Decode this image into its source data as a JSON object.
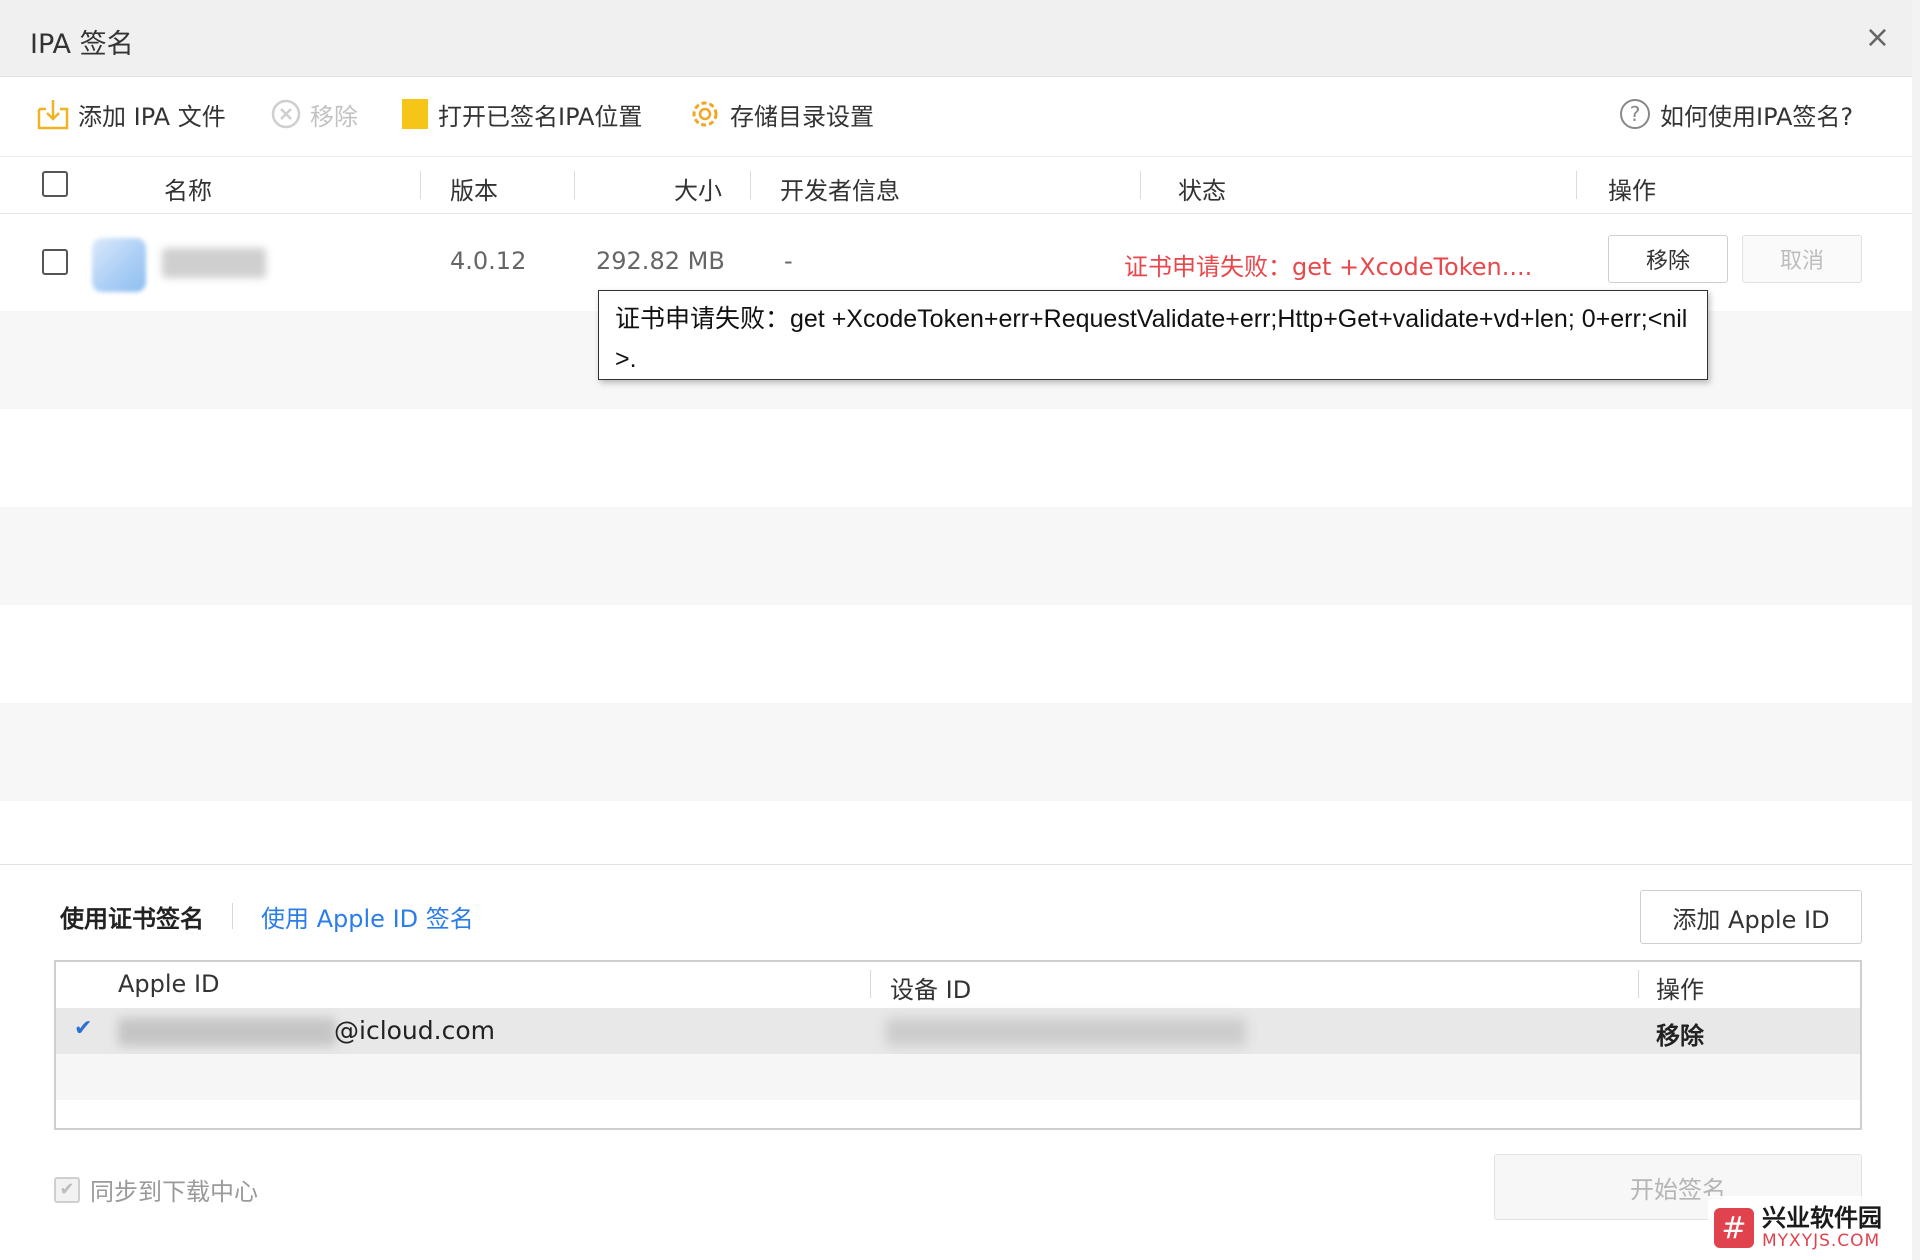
{
  "window": {
    "title": "IPA 签名",
    "close_glyph": "×"
  },
  "toolbar": {
    "add_ipa": "添加 IPA 文件",
    "remove": "移除",
    "open_signed": "打开已签名IPA位置",
    "storage_settings": "存储目录设置",
    "help": "如何使用IPA签名?"
  },
  "table": {
    "headers": {
      "name": "名称",
      "version": "版本",
      "size": "大小",
      "developer": "开发者信息",
      "status": "状态",
      "actions": "操作"
    },
    "rows": [
      {
        "version": "4.0.12",
        "size": "292.82 MB",
        "developer": "-",
        "status": "证书申请失败：get +XcodeToken....",
        "remove_label": "移除",
        "cancel_label": "取消"
      }
    ]
  },
  "tooltip": {
    "text": "证书申请失败：get +XcodeToken+err+RequestValidate+err;Http+Get+validate+vd+len; 0+err;<nil>."
  },
  "signing": {
    "tab_certificate": "使用证书签名",
    "tab_apple_id": "使用 Apple ID 签名",
    "add_apple_id": "添加 Apple ID",
    "headers": {
      "apple_id": "Apple ID",
      "device_id": "设备 ID",
      "actions": "操作"
    },
    "rows": [
      {
        "check": "✔",
        "email_suffix": "@icloud.com",
        "remove_label": "移除"
      }
    ],
    "sync_label": "同步到下载中心",
    "start_label": "开始签名"
  },
  "watermark": {
    "logo": "#",
    "cn": "兴业软件园",
    "en": "MYXYJS.COM"
  },
  "colors": {
    "accent": "#2b7de9",
    "error": "#e8474b",
    "folder": "#f5c518"
  }
}
